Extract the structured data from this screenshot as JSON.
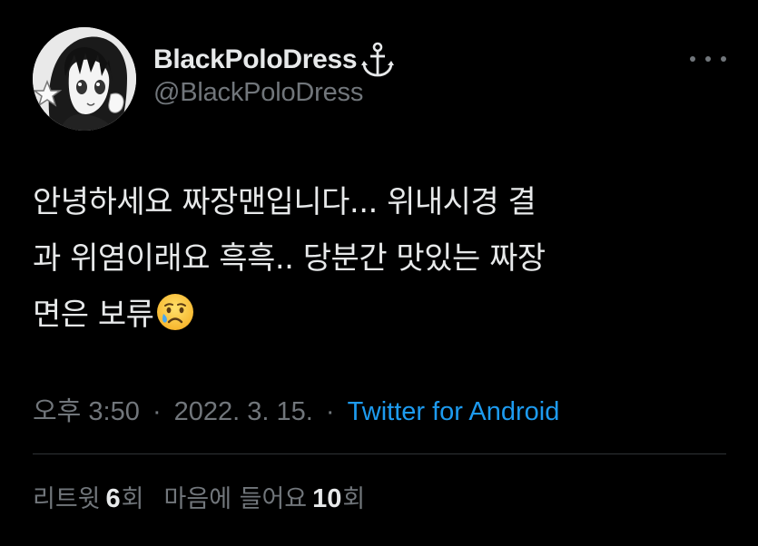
{
  "user": {
    "display_name": "BlackPoloDress",
    "handle": "@BlackPoloDress",
    "name_icon": "anchor-icon",
    "avatar_icon": "avatar-anime-girl"
  },
  "menu": {
    "more_icon": "more-dots-icon"
  },
  "tweet": {
    "lines": [
      "안녕하세요 짜장맨입니다... 위내시경 결",
      "과 위염이래요 흑흑.. 당분간 맛있는 짜장",
      "면은 보류"
    ],
    "trailing_emoji": "crying-face-emoji"
  },
  "meta": {
    "time": "오후 3:50",
    "separator": "·",
    "date": "2022. 3. 15.",
    "source": "Twitter for Android"
  },
  "stats": {
    "retweets_label_pre": "리트윗",
    "retweets_count": "6",
    "retweets_label_post": "회",
    "likes_label_pre": "마음에 들어요",
    "likes_count": "10",
    "likes_label_post": "회"
  },
  "colors": {
    "background": "#000000",
    "text_primary": "#e7e9ea",
    "text_secondary": "#71767b",
    "link": "#1d9bf0",
    "divider": "#2f3336"
  }
}
